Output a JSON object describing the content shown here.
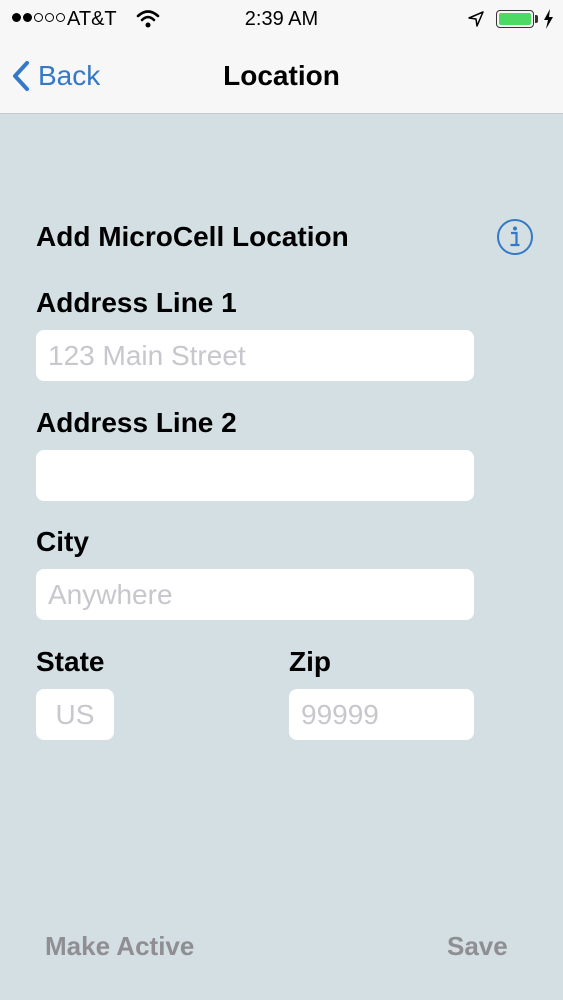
{
  "status_bar": {
    "carrier": "AT&T",
    "time": "2:39 AM"
  },
  "nav": {
    "back_label": "Back",
    "title": "Location"
  },
  "form": {
    "heading": "Add MicroCell Location",
    "address1_label": "Address Line 1",
    "address1_placeholder": "123 Main Street",
    "address2_label": "Address Line 2",
    "address2_placeholder": "",
    "city_label": "City",
    "city_placeholder": "Anywhere",
    "state_label": "State",
    "state_placeholder": "US",
    "zip_label": "Zip",
    "zip_placeholder": "99999"
  },
  "actions": {
    "make_active_label": "Make Active",
    "save_label": "Save"
  },
  "colors": {
    "accent": "#3478c6",
    "background": "#d4dfe3",
    "disabled": "#8e8e93",
    "battery": "#4cd964"
  },
  "icons": [
    "signal-dots-icon",
    "wifi-icon",
    "location-arrow-icon",
    "battery-icon",
    "charging-bolt-icon",
    "chevron-left-icon",
    "info-icon"
  ]
}
